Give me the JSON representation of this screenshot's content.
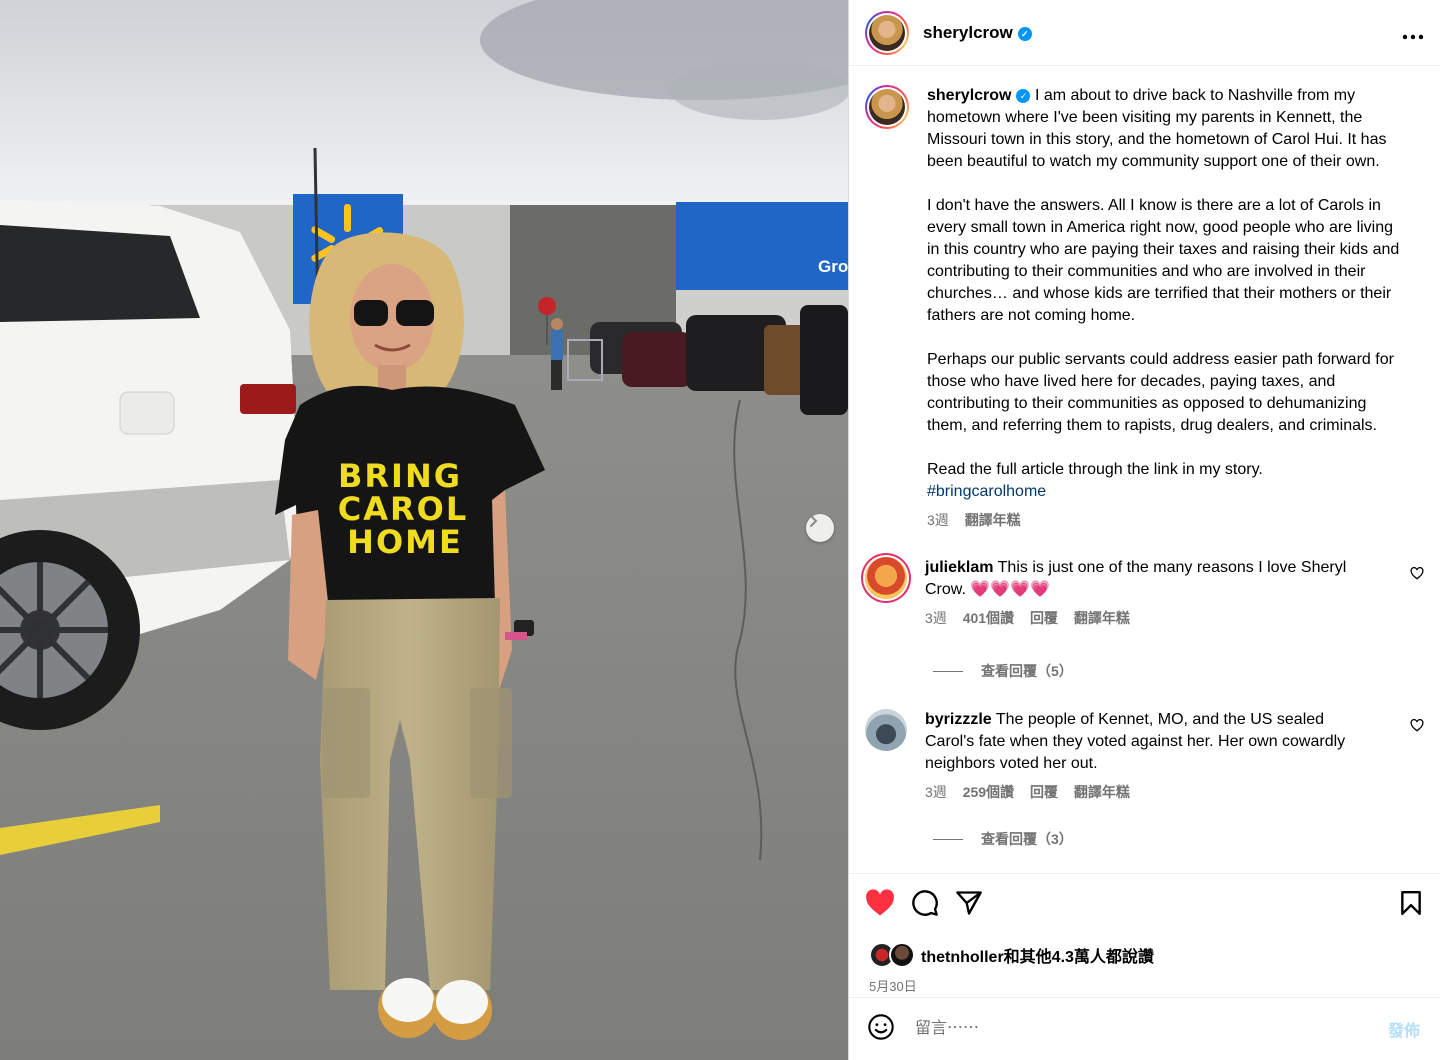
{
  "post": {
    "author": "sherylcrow",
    "verified": true,
    "more_icon": "more-horizontal-icon"
  },
  "photo": {
    "shirt_lines": [
      "BRING",
      "CAROL",
      "HOME"
    ],
    "store_sign": "Gro",
    "next_icon": "chevron-right-icon"
  },
  "caption": {
    "author": "sherylcrow",
    "paragraphs": [
      "I am about to drive back to Nashville from my hometown where I've been visiting my parents in Kennett, the Missouri town in this story, and the hometown of Carol Hui. It has been beautiful to watch my community support one of their own.",
      "I don't have the answers. All I know is there are a lot of Carols in every small town in America right now, good people who are living in this country who are paying their taxes and raising their kids and contributing to their communities and who are involved in their churches… and whose kids are terrified that their mothers or their fathers are not coming home.",
      "Perhaps our public servants could address easier path forward for those who have lived here for decades, paying taxes, and contributing to their communities as opposed to dehumanizing them, and referring them to rapists, drug dealers, and criminals."
    ],
    "last_line": "Read the full article through the link in my story.",
    "hashtag": "#bringcarolhome",
    "time": "3週",
    "translate": "翻譯年糕"
  },
  "comments": [
    {
      "user": "julieklam",
      "text": "This is just one of the many reasons I love Sheryl Crow. 💗💗💗💗",
      "time": "3週",
      "likes": "401個讚",
      "reply": "回覆",
      "translate": "翻譯年糕",
      "view_replies": "查看回覆（5）"
    },
    {
      "user": "byrizzzle",
      "text": "The people of Kennet, MO, and the US sealed Carol's fate when they voted against her. Her own cowardly neighbors voted her out.",
      "time": "3週",
      "likes": "259個讚",
      "reply": "回覆",
      "translate": "翻譯年糕",
      "view_replies": "查看回覆（3）"
    }
  ],
  "actions": {
    "liked": true,
    "like_color": "#ff3040",
    "likes_text": "thetnholler和其他4.3萬人都說讚",
    "date": "5月30日"
  },
  "composer": {
    "placeholder": "留言⋯⋯",
    "post_label": "發佈",
    "post_color": "#b2dffc"
  }
}
